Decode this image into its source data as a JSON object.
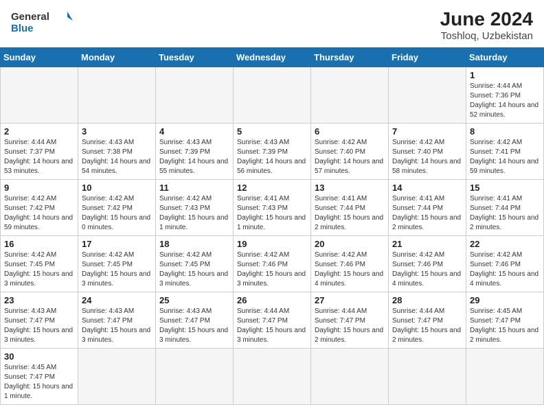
{
  "header": {
    "logo_general": "General",
    "logo_blue": "Blue",
    "month_year": "June 2024",
    "location": "Toshloq, Uzbekistan"
  },
  "days_of_week": [
    "Sunday",
    "Monday",
    "Tuesday",
    "Wednesday",
    "Thursday",
    "Friday",
    "Saturday"
  ],
  "weeks": [
    [
      {
        "day": "",
        "empty": true
      },
      {
        "day": "",
        "empty": true
      },
      {
        "day": "",
        "empty": true
      },
      {
        "day": "",
        "empty": true
      },
      {
        "day": "",
        "empty": true
      },
      {
        "day": "",
        "empty": true
      },
      {
        "day": "1",
        "sunrise": "4:44 AM",
        "sunset": "7:36 PM",
        "daylight": "14 hours and 52 minutes."
      }
    ],
    [
      {
        "day": "2",
        "sunrise": "4:44 AM",
        "sunset": "7:37 PM",
        "daylight": "14 hours and 53 minutes."
      },
      {
        "day": "3",
        "sunrise": "4:43 AM",
        "sunset": "7:38 PM",
        "daylight": "14 hours and 54 minutes."
      },
      {
        "day": "4",
        "sunrise": "4:43 AM",
        "sunset": "7:39 PM",
        "daylight": "14 hours and 55 minutes."
      },
      {
        "day": "5",
        "sunrise": "4:43 AM",
        "sunset": "7:39 PM",
        "daylight": "14 hours and 56 minutes."
      },
      {
        "day": "6",
        "sunrise": "4:42 AM",
        "sunset": "7:40 PM",
        "daylight": "14 hours and 57 minutes."
      },
      {
        "day": "7",
        "sunrise": "4:42 AM",
        "sunset": "7:40 PM",
        "daylight": "14 hours and 58 minutes."
      },
      {
        "day": "8",
        "sunrise": "4:42 AM",
        "sunset": "7:41 PM",
        "daylight": "14 hours and 59 minutes."
      }
    ],
    [
      {
        "day": "9",
        "sunrise": "4:42 AM",
        "sunset": "7:42 PM",
        "daylight": "14 hours and 59 minutes."
      },
      {
        "day": "10",
        "sunrise": "4:42 AM",
        "sunset": "7:42 PM",
        "daylight": "15 hours and 0 minutes."
      },
      {
        "day": "11",
        "sunrise": "4:42 AM",
        "sunset": "7:43 PM",
        "daylight": "15 hours and 1 minute."
      },
      {
        "day": "12",
        "sunrise": "4:41 AM",
        "sunset": "7:43 PM",
        "daylight": "15 hours and 1 minute."
      },
      {
        "day": "13",
        "sunrise": "4:41 AM",
        "sunset": "7:44 PM",
        "daylight": "15 hours and 2 minutes."
      },
      {
        "day": "14",
        "sunrise": "4:41 AM",
        "sunset": "7:44 PM",
        "daylight": "15 hours and 2 minutes."
      },
      {
        "day": "15",
        "sunrise": "4:41 AM",
        "sunset": "7:44 PM",
        "daylight": "15 hours and 2 minutes."
      }
    ],
    [
      {
        "day": "16",
        "sunrise": "4:42 AM",
        "sunset": "7:45 PM",
        "daylight": "15 hours and 3 minutes."
      },
      {
        "day": "17",
        "sunrise": "4:42 AM",
        "sunset": "7:45 PM",
        "daylight": "15 hours and 3 minutes."
      },
      {
        "day": "18",
        "sunrise": "4:42 AM",
        "sunset": "7:45 PM",
        "daylight": "15 hours and 3 minutes."
      },
      {
        "day": "19",
        "sunrise": "4:42 AM",
        "sunset": "7:46 PM",
        "daylight": "15 hours and 3 minutes."
      },
      {
        "day": "20",
        "sunrise": "4:42 AM",
        "sunset": "7:46 PM",
        "daylight": "15 hours and 4 minutes."
      },
      {
        "day": "21",
        "sunrise": "4:42 AM",
        "sunset": "7:46 PM",
        "daylight": "15 hours and 4 minutes."
      },
      {
        "day": "22",
        "sunrise": "4:42 AM",
        "sunset": "7:46 PM",
        "daylight": "15 hours and 4 minutes."
      }
    ],
    [
      {
        "day": "23",
        "sunrise": "4:43 AM",
        "sunset": "7:47 PM",
        "daylight": "15 hours and 3 minutes."
      },
      {
        "day": "24",
        "sunrise": "4:43 AM",
        "sunset": "7:47 PM",
        "daylight": "15 hours and 3 minutes."
      },
      {
        "day": "25",
        "sunrise": "4:43 AM",
        "sunset": "7:47 PM",
        "daylight": "15 hours and 3 minutes."
      },
      {
        "day": "26",
        "sunrise": "4:44 AM",
        "sunset": "7:47 PM",
        "daylight": "15 hours and 3 minutes."
      },
      {
        "day": "27",
        "sunrise": "4:44 AM",
        "sunset": "7:47 PM",
        "daylight": "15 hours and 2 minutes."
      },
      {
        "day": "28",
        "sunrise": "4:44 AM",
        "sunset": "7:47 PM",
        "daylight": "15 hours and 2 minutes."
      },
      {
        "day": "29",
        "sunrise": "4:45 AM",
        "sunset": "7:47 PM",
        "daylight": "15 hours and 2 minutes."
      }
    ],
    [
      {
        "day": "30",
        "sunrise": "4:45 AM",
        "sunset": "7:47 PM",
        "daylight": "15 hours and 1 minute."
      },
      {
        "day": "",
        "empty": true
      },
      {
        "day": "",
        "empty": true
      },
      {
        "day": "",
        "empty": true
      },
      {
        "day": "",
        "empty": true
      },
      {
        "day": "",
        "empty": true
      },
      {
        "day": "",
        "empty": true
      }
    ]
  ],
  "sunrise_label": "Sunrise:",
  "sunset_label": "Sunset:",
  "daylight_label": "Daylight:"
}
